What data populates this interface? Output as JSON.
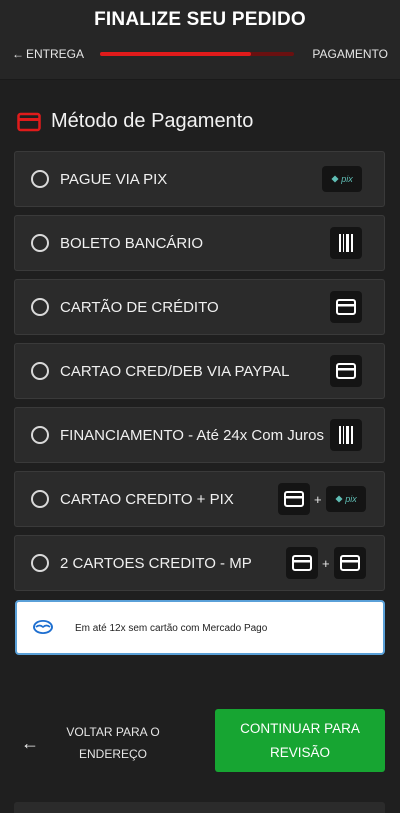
{
  "header": {
    "title": "FINALIZE SEU PEDIDO",
    "back_step_label": "ENTREGA",
    "current_step_label": "PAGAMENTO",
    "progress_percent": 78
  },
  "section": {
    "title": "Método de Pagamento",
    "icon": "credit-card-icon"
  },
  "payment_options": [
    {
      "label": "PAGUE VIA PIX",
      "icons": [
        "pix-icon"
      ]
    },
    {
      "label": "BOLETO BANCÁRIO",
      "icons": [
        "barcode-icon"
      ]
    },
    {
      "label": "CARTÃO DE CRÉDITO",
      "icons": [
        "credit-card-icon"
      ]
    },
    {
      "label": "CARTAO CRED/DEB VIA PAYPAL",
      "icons": [
        "credit-card-icon"
      ]
    },
    {
      "label": "FINANCIAMENTO - Até 24x Com Juros",
      "icons": [
        "barcode-icon"
      ]
    },
    {
      "label": "CARTAO CREDITO + PIX",
      "icons": [
        "credit-card-icon",
        "pix-icon"
      ],
      "separator": "+"
    },
    {
      "label": "2 CARTOES CREDITO - MP",
      "icons": [
        "credit-card-icon",
        "credit-card-icon"
      ],
      "separator": "+"
    }
  ],
  "mercado_pago": {
    "text": "Em até 12x sem cartão com Mercado Pago"
  },
  "pix_logo_text": "pix",
  "footer": {
    "back_label_line1": "VOLTAR PARA O",
    "back_label_line2": "ENDEREÇO",
    "continue_label_line1": "CONTINUAR PARA",
    "continue_label_line2": "REVISÃO"
  },
  "colors": {
    "accent_red": "#e01b1b",
    "continue_green": "#17a532",
    "background": "#1f1f1f"
  }
}
